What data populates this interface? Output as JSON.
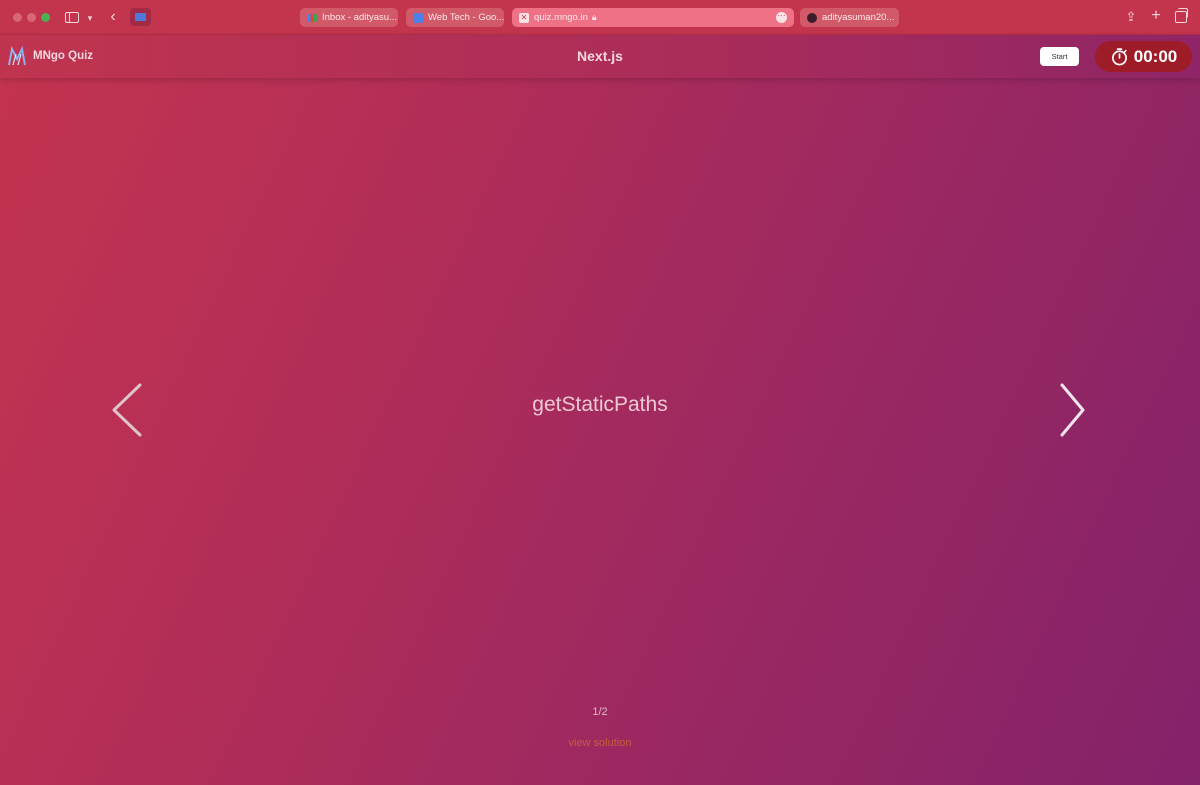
{
  "browser": {
    "tabs": [
      {
        "label": "Inbox - adityasu..."
      },
      {
        "label": "Web Tech - Goo..."
      },
      {
        "label": "quiz.mngo.in"
      },
      {
        "label": "adityasuman20..."
      }
    ],
    "extension_icon": "extension-icon"
  },
  "header": {
    "brand": "MNgo Quiz",
    "title": "Next.js",
    "start_label": "Start",
    "timer": "00:00"
  },
  "card": {
    "question": "getStaticPaths",
    "counter": "1/2",
    "solution_link": "view solution"
  },
  "colors": {
    "gradient_start": "#c5344f",
    "gradient_end": "#84226a",
    "timer_bg": "#9e1c27",
    "solution_link": "#c25f3a"
  }
}
